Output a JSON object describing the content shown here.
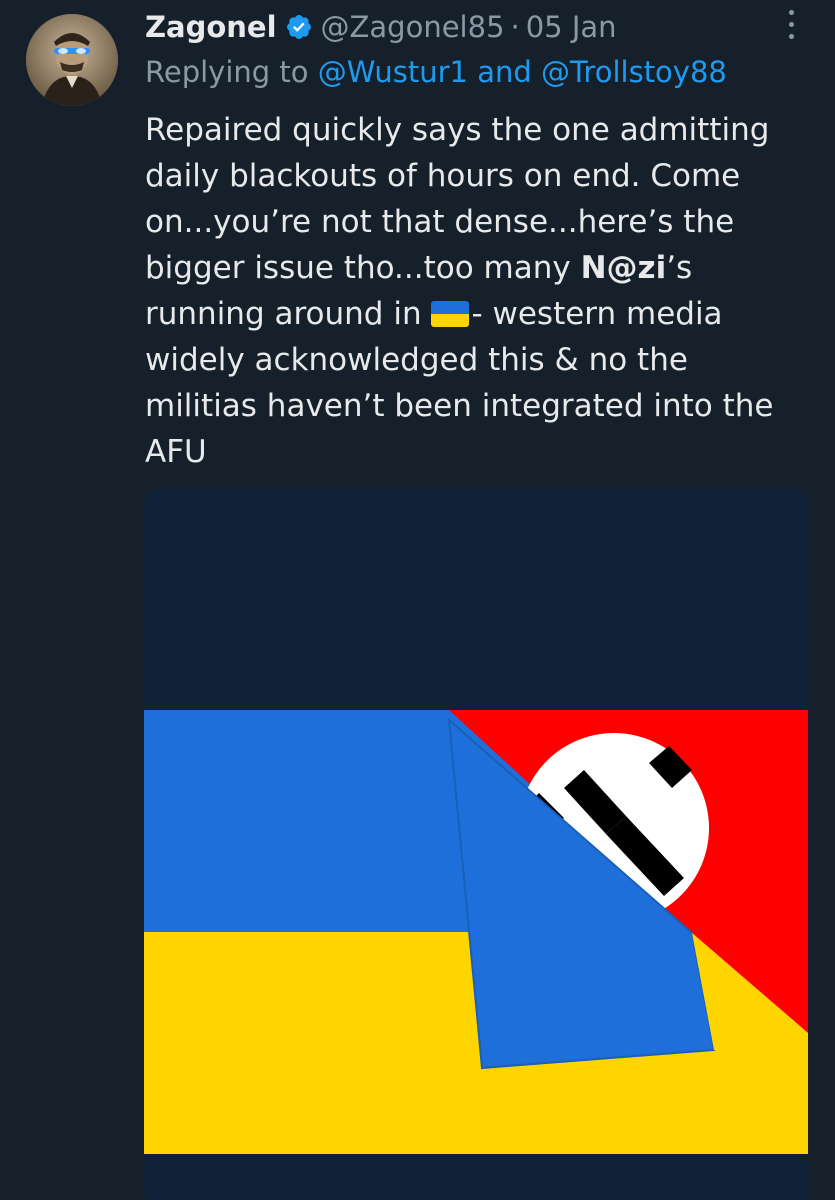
{
  "tweet": {
    "display_name": "Zagonel",
    "verified_icon": "verified-badge-icon",
    "handle": "@Zagonel85",
    "separator": "·",
    "date": "05 Jan",
    "more_icon": "more-vertical-icon",
    "reply_prefix": "Replying to",
    "reply_mention_1": "@Wustur1",
    "reply_and": "and",
    "reply_mention_2": "@Trollstoy88",
    "body_lines": [
      "Repaired quickly says the one admitting",
      "daily blackouts of hours on end. Come",
      "on...you’re not that dense...here’s the",
      "bigger issue tho...too many "
    ],
    "body_bold": "N@zi",
    "body_after_bold": "’s",
    "line5_start": "running around in ",
    "flag_emoji": "ukraine-flag-emoji",
    "line5_end": "- western media",
    "body_lines_rest": [
      "widely acknowledged this & no the",
      "militias haven’t been integrated into the",
      "AFU"
    ]
  },
  "colors": {
    "background": "#15202b",
    "accent_link": "#1d9bf0",
    "muted_text": "#8b98a5",
    "flag_blue": "#1e6fd9",
    "flag_yellow": "#ffd500",
    "red": "#ff0000"
  }
}
